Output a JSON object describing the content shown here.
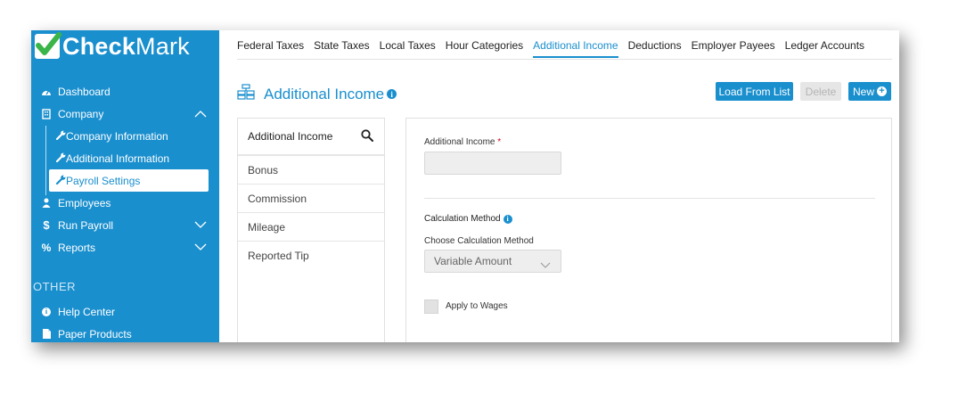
{
  "app": {
    "logo_bold": "Check",
    "logo_light": "Mark",
    "brand_color": "#1a8fce"
  },
  "sidebar": {
    "items": [
      {
        "label": "Dashboard",
        "icon": "dashboard-icon"
      },
      {
        "label": "Company",
        "icon": "building-icon",
        "expanded": true
      },
      {
        "label": "Employees",
        "icon": "user-icon"
      },
      {
        "label": "Run Payroll",
        "icon": "dollar-icon"
      },
      {
        "label": "Reports",
        "icon": "percent-icon"
      }
    ],
    "company_sub": [
      {
        "label": "Company Information",
        "icon": "wrench-icon"
      },
      {
        "label": "Additional Information",
        "icon": "wrench-icon"
      },
      {
        "label": "Payroll Settings",
        "icon": "wrench-icon",
        "active": true
      }
    ],
    "other_label": "OTHER",
    "other_items": [
      {
        "label": "Help Center",
        "icon": "info-icon"
      },
      {
        "label": "Paper Products",
        "icon": "document-icon"
      }
    ]
  },
  "tabs": [
    "Federal Taxes",
    "State Taxes",
    "Local Taxes",
    "Hour Categories",
    "Additional Income",
    "Deductions",
    "Employer Payees",
    "Ledger Accounts"
  ],
  "active_tab": "Additional Income",
  "header": {
    "title": "Additional Income",
    "title_info": "i",
    "load_button": "Load From List",
    "delete_button": "Delete",
    "new_button": "New",
    "new_plus": "+"
  },
  "list": {
    "header": "Additional Income",
    "items": [
      "Bonus",
      "Commission",
      "Mileage",
      "Reported Tip"
    ]
  },
  "form": {
    "income_label": "Additional Income",
    "required_mark": "*",
    "income_value": "",
    "calc_title": "Calculation Method",
    "calc_info": "i",
    "calc_choose_label": "Choose Calculation Method",
    "calc_selected": "Variable Amount",
    "apply_wages_label": "Apply to Wages",
    "apply_wages_checked": false
  }
}
